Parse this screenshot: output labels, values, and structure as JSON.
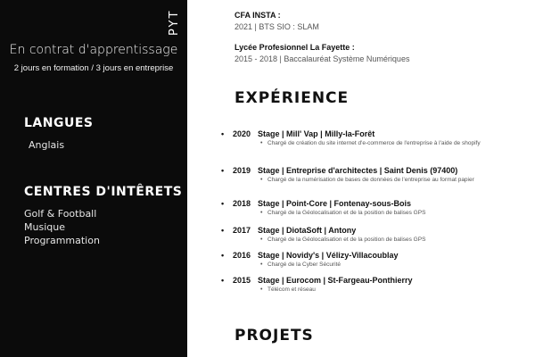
{
  "sidebar": {
    "vertical_text": "PYT",
    "contract": "En contrat d'apprentissage",
    "schedule": "2 jours en formation / 3 jours en entreprise",
    "languages_title": "LANGUES",
    "languages": [
      "Anglais"
    ],
    "interests_title": "CENTRES D'INTÊRETS",
    "interests": [
      "Golf & Football",
      "Musique",
      "Programmation"
    ]
  },
  "education": [
    {
      "school": "CFA INSTA :",
      "detail": "2021 | BTS SIO : SLAM"
    },
    {
      "school": "Lycée Profesionnel La Fayette :",
      "detail": "2015 - 2018 | Baccalauréat Système Numériques"
    }
  ],
  "experience_title": "EXPÉRIENCE",
  "experience": [
    {
      "year": "2020",
      "title": "Stage | Mill' Vap  |  Milly-la-Forêt",
      "desc": "Chargé de  création du site internet d'e-commerce de l'entreprise à l'aide de shopify"
    },
    {
      "year": "2019",
      "title": "Stage | Entreprise d'architectes | Saint Denis (97400)",
      "desc": "Chargé de la numérisation de bases de données de l'entreprise au format papier"
    },
    {
      "year": "2018",
      "title": "Stage | Point-Core | Fontenay-sous-Bois",
      "desc": "Chargé de la Géolocalisation et de la position de balises GPS"
    },
    {
      "year": "2017",
      "title": "Stage | DiotaSoft | Antony",
      "desc": "Chargé de la Géolocalisation et de la position de balises GPS"
    },
    {
      "year": "2016",
      "title": "Stage | Novidy's | Vélizy-Villacoublay",
      "desc": "Chargé de la Cyber Sécurité"
    },
    {
      "year": "2015",
      "title": "Stage | Eurocom | St-Fargeau-Ponthierry",
      "desc": "Télécom et réseau"
    }
  ],
  "projects_title": "PROJETS"
}
